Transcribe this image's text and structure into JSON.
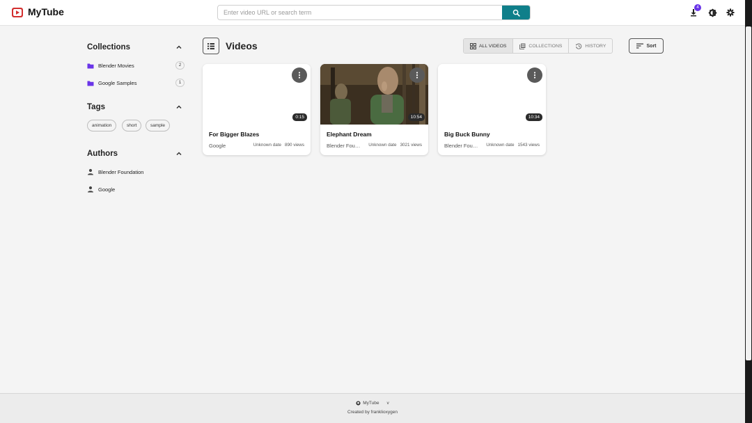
{
  "app": {
    "title": "MyTube",
    "brand_color": "#d32f2f",
    "accent_color": "#0f7f8a"
  },
  "header": {
    "search_placeholder": "Enter video URL or search term",
    "search_icon": "search-icon",
    "download_badge": "4",
    "icons": [
      "download-icon",
      "theme-toggle-icon",
      "settings-icon"
    ]
  },
  "sidebar": {
    "collections": {
      "title": "Collections",
      "items": [
        {
          "label": "Blender Movies",
          "count": "2",
          "icon": "folder-icon"
        },
        {
          "label": "Google Samples",
          "count": "1",
          "icon": "folder-icon"
        }
      ]
    },
    "tags": {
      "title": "Tags",
      "items": [
        "animation",
        "short",
        "sample"
      ]
    },
    "authors": {
      "title": "Authors",
      "items": [
        {
          "label": "Blender Foundation",
          "icon": "person-icon"
        },
        {
          "label": "Google",
          "icon": "person-icon"
        }
      ]
    }
  },
  "main": {
    "title": "Videos",
    "view_tabs": [
      {
        "label": "ALL VIDEOS",
        "active": true,
        "icon": "grid-icon"
      },
      {
        "label": "COLLECTIONS",
        "active": false,
        "icon": "library-icon"
      },
      {
        "label": "HISTORY",
        "active": false,
        "icon": "history-icon"
      }
    ],
    "sort_label": "Sort",
    "videos": [
      {
        "title": "For Bigger Blazes",
        "author": "Google",
        "date": "Unknown date",
        "views": "890 views",
        "duration": "0:15"
      },
      {
        "title": "Elephant Dream",
        "author": "Blender Foundation",
        "date": "Unknown date",
        "views": "3021 views",
        "duration": "10:54"
      },
      {
        "title": "Big Buck Bunny",
        "author": "Blender Foundation",
        "date": "Unknown date",
        "views": "1543 views",
        "duration": "10:34"
      }
    ]
  },
  "footer": {
    "app_link": "MyTube",
    "version": "v",
    "credit": "Created by franklioxygen"
  }
}
